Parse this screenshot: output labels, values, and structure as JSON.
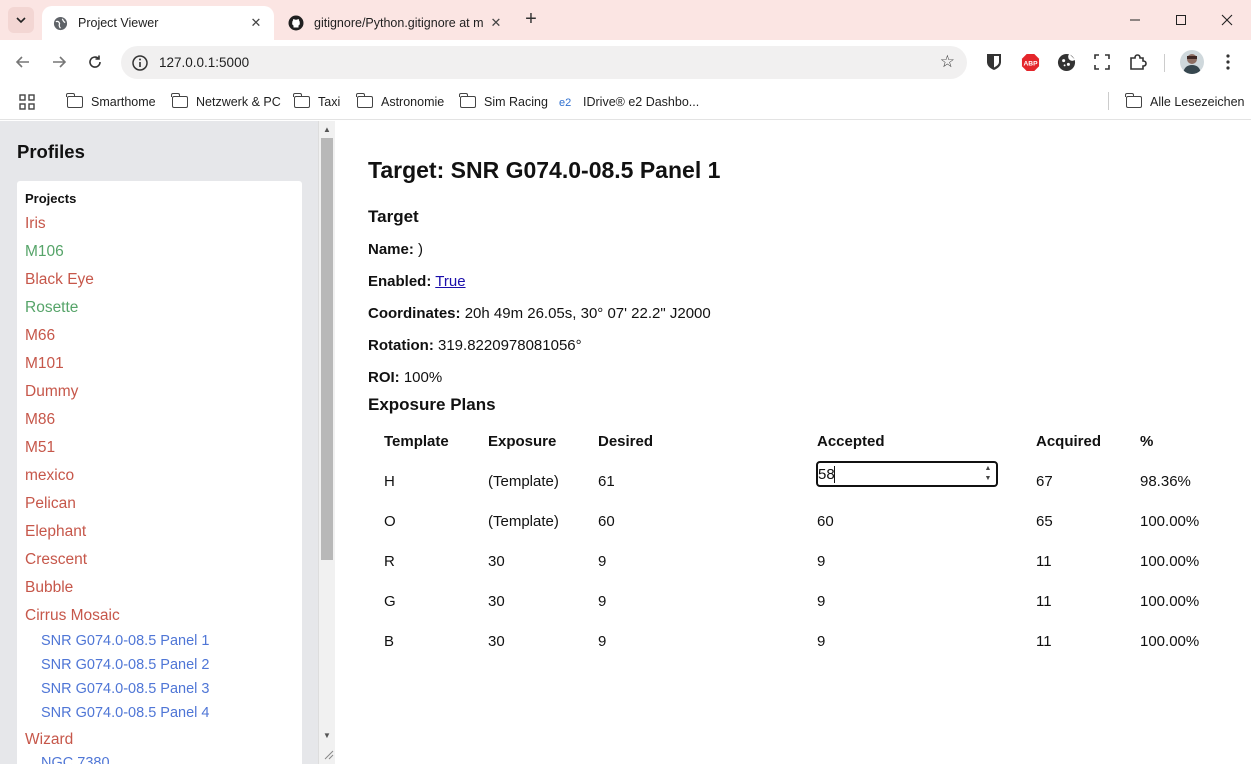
{
  "browser": {
    "tabs": [
      {
        "title": "Project Viewer",
        "active": true
      },
      {
        "title": "gitignore/Python.gitignore at m",
        "active": false
      }
    ],
    "url": "127.0.0.1:5000",
    "bookmarks": [
      {
        "label": "Smarthome",
        "type": "folder"
      },
      {
        "label": "Netzwerk & PC",
        "type": "folder"
      },
      {
        "label": "Taxi",
        "type": "folder"
      },
      {
        "label": "Astronomie",
        "type": "folder"
      },
      {
        "label": "Sim Racing",
        "type": "folder"
      },
      {
        "label": "IDrive® e2 Dashbo...",
        "type": "link"
      },
      {
        "label": "Alle Lesezeichen",
        "type": "folder"
      }
    ],
    "extensions": [
      "bitwarden-icon",
      "adblock-icon",
      "cookie-icon",
      "screenshot-icon",
      "puzzle-icon"
    ]
  },
  "sidebar": {
    "title": "Profiles",
    "section_header": "Projects",
    "projects": [
      {
        "label": "Iris",
        "color": "red"
      },
      {
        "label": "M106",
        "color": "green"
      },
      {
        "label": "Black Eye",
        "color": "red"
      },
      {
        "label": "Rosette",
        "color": "green"
      },
      {
        "label": "M66",
        "color": "red"
      },
      {
        "label": "M101",
        "color": "red"
      },
      {
        "label": "Dummy",
        "color": "red"
      },
      {
        "label": "M86",
        "color": "red"
      },
      {
        "label": "M51",
        "color": "red"
      },
      {
        "label": "mexico",
        "color": "red"
      },
      {
        "label": "Pelican",
        "color": "red"
      },
      {
        "label": "Elephant",
        "color": "red"
      },
      {
        "label": "Crescent",
        "color": "red"
      },
      {
        "label": "Bubble",
        "color": "red"
      },
      {
        "label": "Cirrus Mosaic",
        "color": "red"
      },
      {
        "label": "SNR G074.0-08.5 Panel 1",
        "color": "blue"
      },
      {
        "label": "SNR G074.0-08.5 Panel 2",
        "color": "blue"
      },
      {
        "label": "SNR G074.0-08.5 Panel 3",
        "color": "blue"
      },
      {
        "label": "SNR G074.0-08.5 Panel 4",
        "color": "blue"
      },
      {
        "label": "Wizard",
        "color": "red"
      },
      {
        "label": "NGC 7380",
        "color": "blue"
      }
    ],
    "colors": {
      "red": "#c6574a",
      "green": "#56a469",
      "blue": "#4f76d6"
    }
  },
  "main": {
    "title": "Target: SNR G074.0-08.5 Panel 1",
    "target_heading": "Target",
    "fields": {
      "name_label": "Name:",
      "name_value": ")",
      "enabled_label": "Enabled:",
      "enabled_value": "True",
      "coords_label": "Coordinates:",
      "coords_value": "20h 49m 26.05s, 30° 07' 22.2\" J2000",
      "rotation_label": "Rotation:",
      "rotation_value": "319.8220978081056°",
      "roi_label": "ROI:",
      "roi_value": "100%"
    },
    "plans_heading": "Exposure Plans",
    "plans": {
      "columns": [
        "Template",
        "Exposure",
        "Desired",
        "Accepted",
        "Acquired",
        "%"
      ],
      "rows": [
        {
          "template": "H",
          "exposure": "(Template)",
          "desired": "61",
          "accepted": "58",
          "acquired": "67",
          "percent": "98.36%",
          "editing": true
        },
        {
          "template": "O",
          "exposure": "(Template)",
          "desired": "60",
          "accepted": "60",
          "acquired": "65",
          "percent": "100.00%"
        },
        {
          "template": "R",
          "exposure": "30",
          "desired": "9",
          "accepted": "9",
          "acquired": "11",
          "percent": "100.00%"
        },
        {
          "template": "G",
          "exposure": "30",
          "desired": "9",
          "accepted": "9",
          "acquired": "11",
          "percent": "100.00%"
        },
        {
          "template": "B",
          "exposure": "30",
          "desired": "9",
          "accepted": "9",
          "acquired": "11",
          "percent": "100.00%"
        }
      ]
    }
  }
}
